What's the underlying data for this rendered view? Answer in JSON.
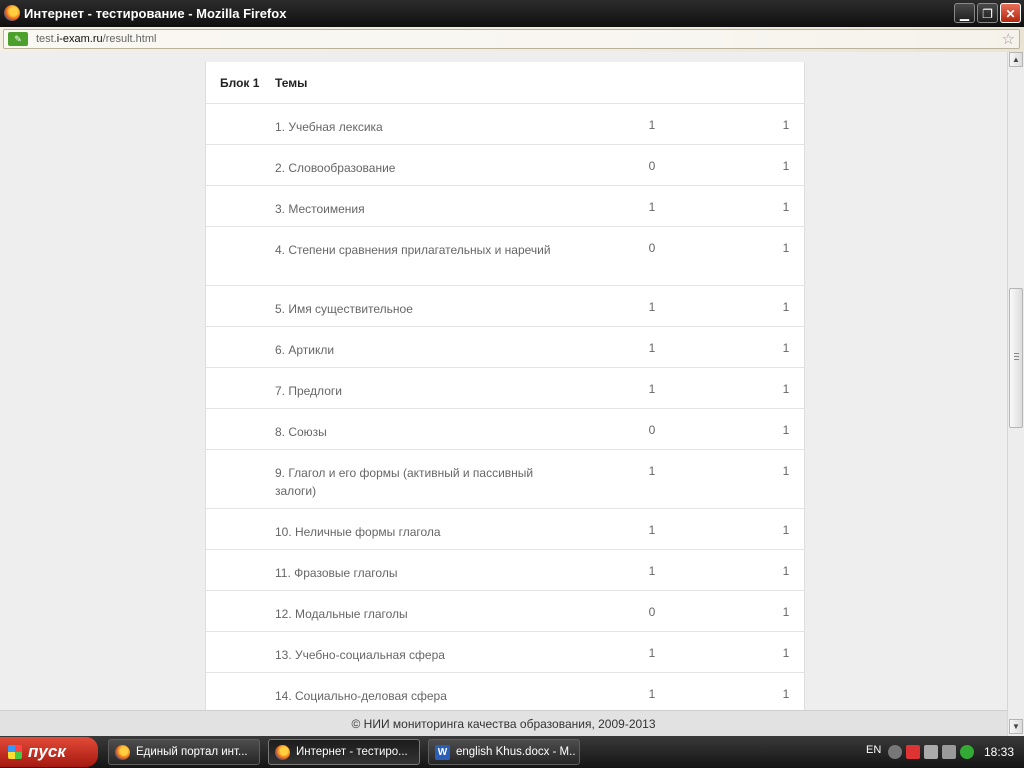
{
  "window": {
    "title": "Интернет - тестирование - Mozilla Firefox",
    "minimize": "▁",
    "restore": "❐",
    "close": "✕"
  },
  "urlbar": {
    "prefix": "test.",
    "domain": "i-exam.ru",
    "path": "/result.html",
    "star": "☆"
  },
  "table": {
    "block_header": "Блок 1",
    "topics_header": "Темы",
    "rows": [
      {
        "topic": "1. Учебная лексика",
        "v1": "1",
        "v2": "1"
      },
      {
        "topic": "2. Словообразование",
        "v1": "0",
        "v2": "1"
      },
      {
        "topic": "3. Местоимения",
        "v1": "1",
        "v2": "1"
      },
      {
        "topic": "4. Степени сравнения прилагательных и наречий",
        "v1": "0",
        "v2": "1"
      },
      {
        "topic": "5. Имя существительное",
        "v1": "1",
        "v2": "1"
      },
      {
        "topic": "6. Артикли",
        "v1": "1",
        "v2": "1"
      },
      {
        "topic": "7. Предлоги",
        "v1": "1",
        "v2": "1"
      },
      {
        "topic": "8. Союзы",
        "v1": "0",
        "v2": "1"
      },
      {
        "topic": "9. Глагол и его формы (активный и пассивный залоги)",
        "v1": "1",
        "v2": "1"
      },
      {
        "topic": "10. Неличные формы глагола",
        "v1": "1",
        "v2": "1"
      },
      {
        "topic": "11. Фразовые глаголы",
        "v1": "1",
        "v2": "1"
      },
      {
        "topic": "12. Модальные глаголы",
        "v1": "0",
        "v2": "1"
      },
      {
        "topic": "13. Учебно-социальная сфера",
        "v1": "1",
        "v2": "1"
      },
      {
        "topic": "14. Социально-деловая сфера",
        "v1": "1",
        "v2": "1"
      }
    ]
  },
  "footer": {
    "text": "© НИИ мониторинга качества образования, 2009-2013"
  },
  "taskbar": {
    "start": "пуск",
    "tasks": [
      {
        "label": "Единый портал инт...",
        "icon": "firefox-icon"
      },
      {
        "label": "Интернет - тестиро...",
        "icon": "firefox-icon"
      },
      {
        "label": "english Khus.docx - M...",
        "icon": "word-icon"
      }
    ],
    "lang": "EN",
    "clock": "18:33"
  }
}
